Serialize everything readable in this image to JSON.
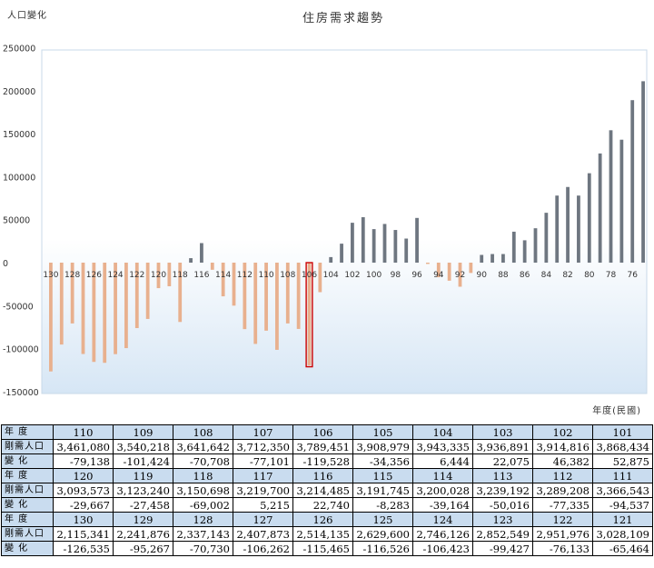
{
  "chart_data": {
    "type": "bar",
    "title": "住房需求趨勢",
    "ylabel": "人口變化",
    "xlabel": "年度(民國)",
    "ylim": [
      -150000,
      250000
    ],
    "yticks": [
      250000,
      200000,
      150000,
      100000,
      50000,
      0,
      -50000,
      -100000,
      -150000
    ],
    "categories": [
      "130",
      "129",
      "128",
      "127",
      "126",
      "125",
      "124",
      "123",
      "122",
      "121",
      "120",
      "119",
      "118",
      "117",
      "116",
      "115",
      "114",
      "113",
      "112",
      "111",
      "110",
      "109",
      "108",
      "107",
      "106",
      "105",
      "104",
      "103",
      "102",
      "101",
      "100",
      "99",
      "98",
      "97",
      "96",
      "95",
      "94",
      "93",
      "92",
      "91",
      "90",
      "89",
      "88",
      "87",
      "86",
      "85",
      "84",
      "83",
      "82",
      "81",
      "80",
      "79",
      "78",
      "77",
      "76",
      "75"
    ],
    "tick_labels_shown": [
      "130",
      "128",
      "126",
      "124",
      "122",
      "120",
      "118",
      "116",
      "114",
      "112",
      "110",
      "108",
      "106",
      "104",
      "102",
      "100",
      "98",
      "96",
      "94",
      "92",
      "90",
      "88",
      "86",
      "84",
      "82",
      "80",
      "78",
      "76"
    ],
    "values": [
      -126535,
      -95267,
      -70730,
      -106262,
      -115465,
      -116526,
      -106423,
      -99427,
      -76133,
      -65464,
      -29667,
      -27458,
      -69002,
      5215,
      22740,
      -8283,
      -39164,
      -50016,
      -77335,
      -94537,
      -79138,
      -101424,
      -70708,
      -77101,
      -119528,
      -34356,
      6444,
      22075,
      46382,
      52875,
      39000,
      45000,
      38000,
      28000,
      52000,
      -1500,
      -17000,
      -21000,
      -28000,
      -12000,
      9000,
      10000,
      10000,
      36000,
      26000,
      40000,
      58000,
      78000,
      88000,
      78000,
      104000,
      127000,
      154000,
      143000,
      189000,
      211000
    ],
    "colors": {
      "negative": "#e8b08e",
      "positive": "#6e7680",
      "highlight_outline": "#cc0000"
    },
    "highlight_category": "106",
    "grid": false
  },
  "table": {
    "row_labels": {
      "year": "年 度",
      "pop": "剛需人口",
      "change": "變 化"
    },
    "blocks": [
      {
        "years": [
          "110",
          "109",
          "108",
          "107",
          "106",
          "105",
          "104",
          "103",
          "102",
          "101"
        ],
        "pop": [
          "3,461,080",
          "3,540,218",
          "3,641,642",
          "3,712,350",
          "3,789,451",
          "3,908,979",
          "3,943,335",
          "3,936,891",
          "3,914,816",
          "3,868,434"
        ],
        "change": [
          "-79,138",
          "-101,424",
          "-70,708",
          "-77,101",
          "-119,528",
          "-34,356",
          "6,444",
          "22,075",
          "46,382",
          "52,875"
        ]
      },
      {
        "years": [
          "120",
          "119",
          "118",
          "117",
          "116",
          "115",
          "114",
          "113",
          "112",
          "111"
        ],
        "pop": [
          "3,093,573",
          "3,123,240",
          "3,150,698",
          "3,219,700",
          "3,214,485",
          "3,191,745",
          "3,200,028",
          "3,239,192",
          "3,289,208",
          "3,366,543"
        ],
        "change": [
          "-29,667",
          "-27,458",
          "-69,002",
          "5,215",
          "22,740",
          "-8,283",
          "-39,164",
          "-50,016",
          "-77,335",
          "-94,537"
        ]
      },
      {
        "years": [
          "130",
          "129",
          "128",
          "127",
          "126",
          "125",
          "124",
          "123",
          "122",
          "121"
        ],
        "pop": [
          "2,115,341",
          "2,241,876",
          "2,337,143",
          "2,407,873",
          "2,514,135",
          "2,629,600",
          "2,746,126",
          "2,852,549",
          "2,951,976",
          "3,028,109"
        ],
        "change": [
          "-126,535",
          "-95,267",
          "-70,730",
          "-106,262",
          "-115,465",
          "-116,526",
          "-106,423",
          "-99,427",
          "-76,133",
          "-65,464"
        ]
      }
    ]
  }
}
